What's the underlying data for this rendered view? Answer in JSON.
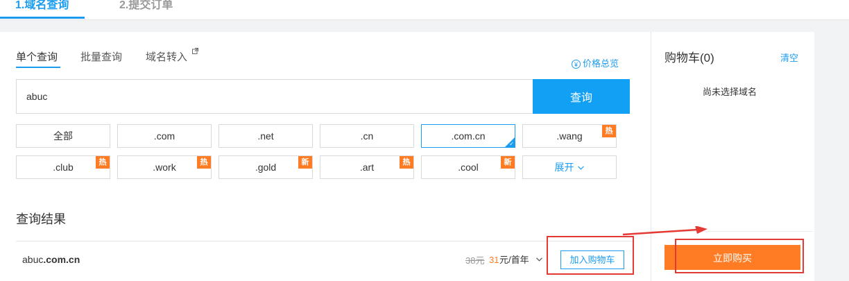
{
  "steps": [
    "1.域名查询",
    "2.提交订单"
  ],
  "mode_tabs": [
    "单个查询",
    "批量查询",
    "域名转入"
  ],
  "price_overview": "价格总览",
  "price_overview_icon": "currency-yen-icon",
  "search": {
    "value": "abuc",
    "button": "查询"
  },
  "tlds": {
    "row1": [
      {
        "label": "全部",
        "badge": ""
      },
      {
        "label": ".com",
        "badge": ""
      },
      {
        "label": ".net",
        "badge": ""
      },
      {
        "label": ".cn",
        "badge": ""
      },
      {
        "label": ".com.cn",
        "badge": "",
        "selected": true
      },
      {
        "label": ".wang",
        "badge": "热"
      }
    ],
    "row2": [
      {
        "label": ".club",
        "badge": "热"
      },
      {
        "label": ".work",
        "badge": "热"
      },
      {
        "label": ".gold",
        "badge": "新"
      },
      {
        "label": ".art",
        "badge": "热"
      },
      {
        "label": ".cool",
        "badge": "新"
      },
      {
        "label": "展开",
        "badge": ""
      }
    ],
    "expand_icon": "chevron-down-icon"
  },
  "results": {
    "title": "查询结果",
    "items": [
      {
        "domain_prefix": "abuc",
        "domain_suffix": ".com.cn",
        "old_price": "38元",
        "new_price": "31",
        "unit": "元/首年",
        "add_button": "加入购物车"
      }
    ]
  },
  "cart": {
    "title": "购物车(0)",
    "clear": "清空",
    "empty_text": "尚未选择域名",
    "buy_button": "立即购买"
  },
  "colors": {
    "accent": "#1a9cf0",
    "search_button": "#12a0f4",
    "orange": "#ff7c24",
    "annotation_red": "#e53935"
  }
}
